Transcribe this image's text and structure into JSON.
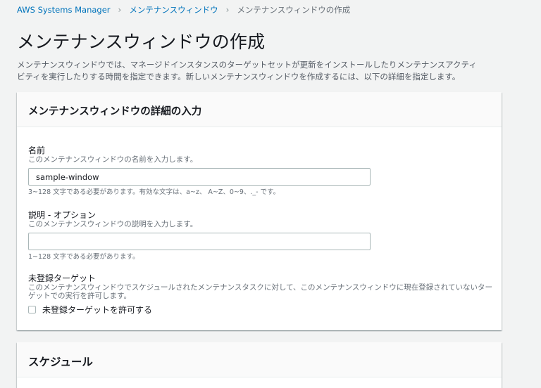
{
  "breadcrumb": {
    "items": [
      "AWS Systems Manager",
      "メンテナンスウィンドウ"
    ],
    "current": "メンテナンスウィンドウの作成",
    "separator": "›"
  },
  "page": {
    "title": "メンテナンスウィンドウの作成",
    "description_line1": "メンテナンスウィンドウでは、マネージドインスタンスのターゲットセットが更新をインストールしたりメンテナンスアクティ",
    "description_line2": "ビティを実行したりする時間を指定できます。新しいメンテナンスウィンドウを作成するには、以下の詳細を指定します。"
  },
  "details_panel": {
    "title": "メンテナンスウィンドウの詳細の入力",
    "name": {
      "label": "名前",
      "description": "このメンテナンスウィンドウの名前を入力します。",
      "value": "sample-window",
      "constraint": "3~128 文字である必要があります。有効な文字は、a~z、 A~Z、0~9、._- です。"
    },
    "description_field": {
      "label": "説明 - オプション",
      "description": "このメンテナンスウィンドウの説明を入力します。",
      "value": "",
      "constraint": "1~128 文字である必要があります。"
    },
    "unregistered_targets": {
      "label": "未登録ターゲット",
      "description_line1": "このメンテナンスウィンドウでスケジュールされたメンテナンスタスクに対して、このメンテナンスウィンドウに現在登録されていないター",
      "description_line2": "ゲットでの実行を許可します。",
      "checkbox_label": "未登録ターゲットを許可する",
      "checked": false
    }
  },
  "schedule_panel": {
    "title": "スケジュール"
  },
  "colors": {
    "link": "#0073bb",
    "background": "#f2f3f3",
    "panel_header": "#fafafa",
    "text_secondary": "#687078"
  }
}
